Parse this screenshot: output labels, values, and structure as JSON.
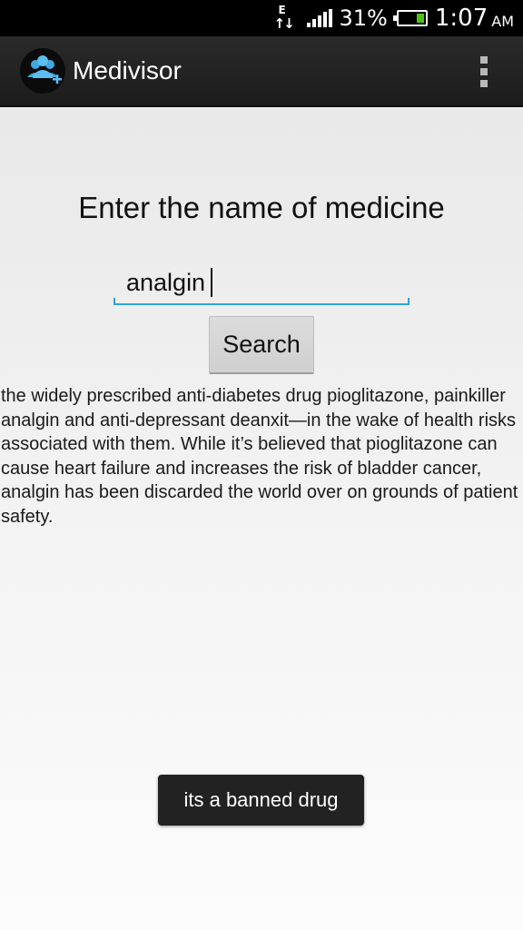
{
  "status_bar": {
    "network_type": "E",
    "battery_percent": "31%",
    "battery_level": 0.31,
    "time": "1:07",
    "ampm": "AM"
  },
  "action_bar": {
    "app_title": "Medivisor",
    "icon": "medivisor-people-plus-icon"
  },
  "main": {
    "heading": "Enter the name of medicine",
    "input_value": "analgin",
    "search_label": "Search",
    "result_text": "the widely prescribed anti-diabetes drug pioglitazone, painkiller analgin and anti-depressant deanxit—in the wake of health risks associated with them. While it’s believed that pioglitazone can cause heart failure and increases the risk of bladder cancer, analgin has been discarded the world over on grounds of patient safety."
  },
  "toast": {
    "message": "its a banned drug"
  },
  "colors": {
    "accent": "#2fa3d4",
    "battery": "#4bc21b",
    "action_bar": "#222222"
  }
}
